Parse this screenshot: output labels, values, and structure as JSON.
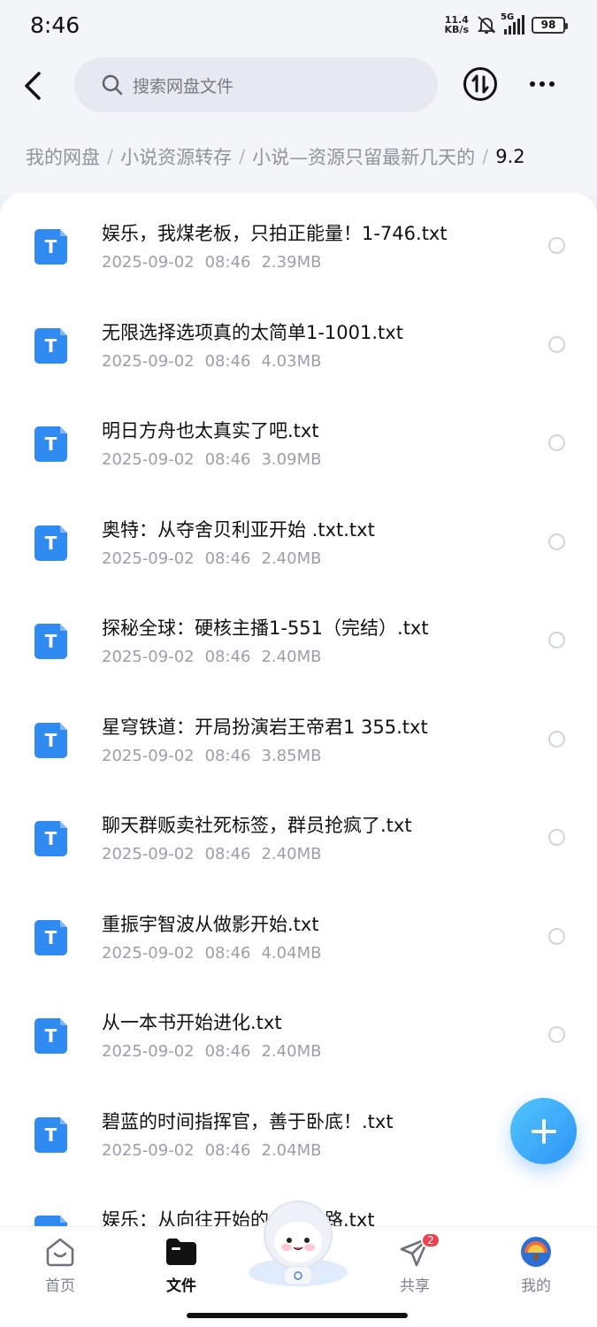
{
  "status_bar": {
    "time": "8:46",
    "net_speed_value": "11.4",
    "net_speed_unit": "KB/s",
    "signal_label": "5G",
    "battery": "98"
  },
  "header": {
    "search_placeholder": "搜索网盘文件"
  },
  "breadcrumb": {
    "items": [
      "我的网盘",
      "小说资源转存",
      "小说—资源只留最新几天的"
    ],
    "current": "9.2"
  },
  "file_icon_letter": "T",
  "files": [
    {
      "name": "娱乐，我煤老板，只拍正能量！1-746.txt",
      "date": "2025-09-02",
      "time": "08:46",
      "size": "2.39MB"
    },
    {
      "name": "无限选择选项真的太简单1-1001.txt",
      "date": "2025-09-02",
      "time": "08:46",
      "size": "4.03MB"
    },
    {
      "name": "明日方舟也太真实了吧.txt",
      "date": "2025-09-02",
      "time": "08:46",
      "size": "3.09MB"
    },
    {
      "name": "奥特：从夺舍贝利亚开始 .txt.txt",
      "date": "2025-09-02",
      "time": "08:46",
      "size": "2.40MB"
    },
    {
      "name": "探秘全球：硬核主播1-551（完结）.txt",
      "date": "2025-09-02",
      "time": "08:46",
      "size": "2.40MB"
    },
    {
      "name": "星穹铁道：开局扮演岩王帝君1 355.txt",
      "date": "2025-09-02",
      "time": "08:46",
      "size": "3.85MB"
    },
    {
      "name": "聊天群贩卖社死标签，群员抢疯了.txt",
      "date": "2025-09-02",
      "time": "08:46",
      "size": "2.40MB"
    },
    {
      "name": "重振宇智波从做影开始.txt",
      "date": "2025-09-02",
      "time": "08:46",
      "size": "4.04MB"
    },
    {
      "name": "从一本书开始进化.txt",
      "date": "2025-09-02",
      "time": "08:46",
      "size": "2.40MB"
    },
    {
      "name": "碧蓝的时间指挥官，善于卧底！.txt",
      "date": "2025-09-02",
      "time": "08:46",
      "size": "2.04MB"
    },
    {
      "name": "娱乐：从向往开始的　　之路.txt",
      "date": "",
      "time": "",
      "size": ""
    }
  ],
  "bottom_nav": {
    "items": [
      {
        "label": "首页",
        "icon": "home-icon",
        "active": false
      },
      {
        "label": "文件",
        "icon": "folder-icon",
        "active": true
      },
      {
        "label": "共享",
        "icon": "share-plane-icon",
        "active": false,
        "badge": "2"
      },
      {
        "label": "我的",
        "icon": "avatar-icon",
        "active": false
      }
    ]
  },
  "colors": {
    "accent": "#2f8af1",
    "fab_gradient_start": "#52c6fb",
    "fab_gradient_end": "#2d93f7",
    "badge": "#f0424e"
  }
}
